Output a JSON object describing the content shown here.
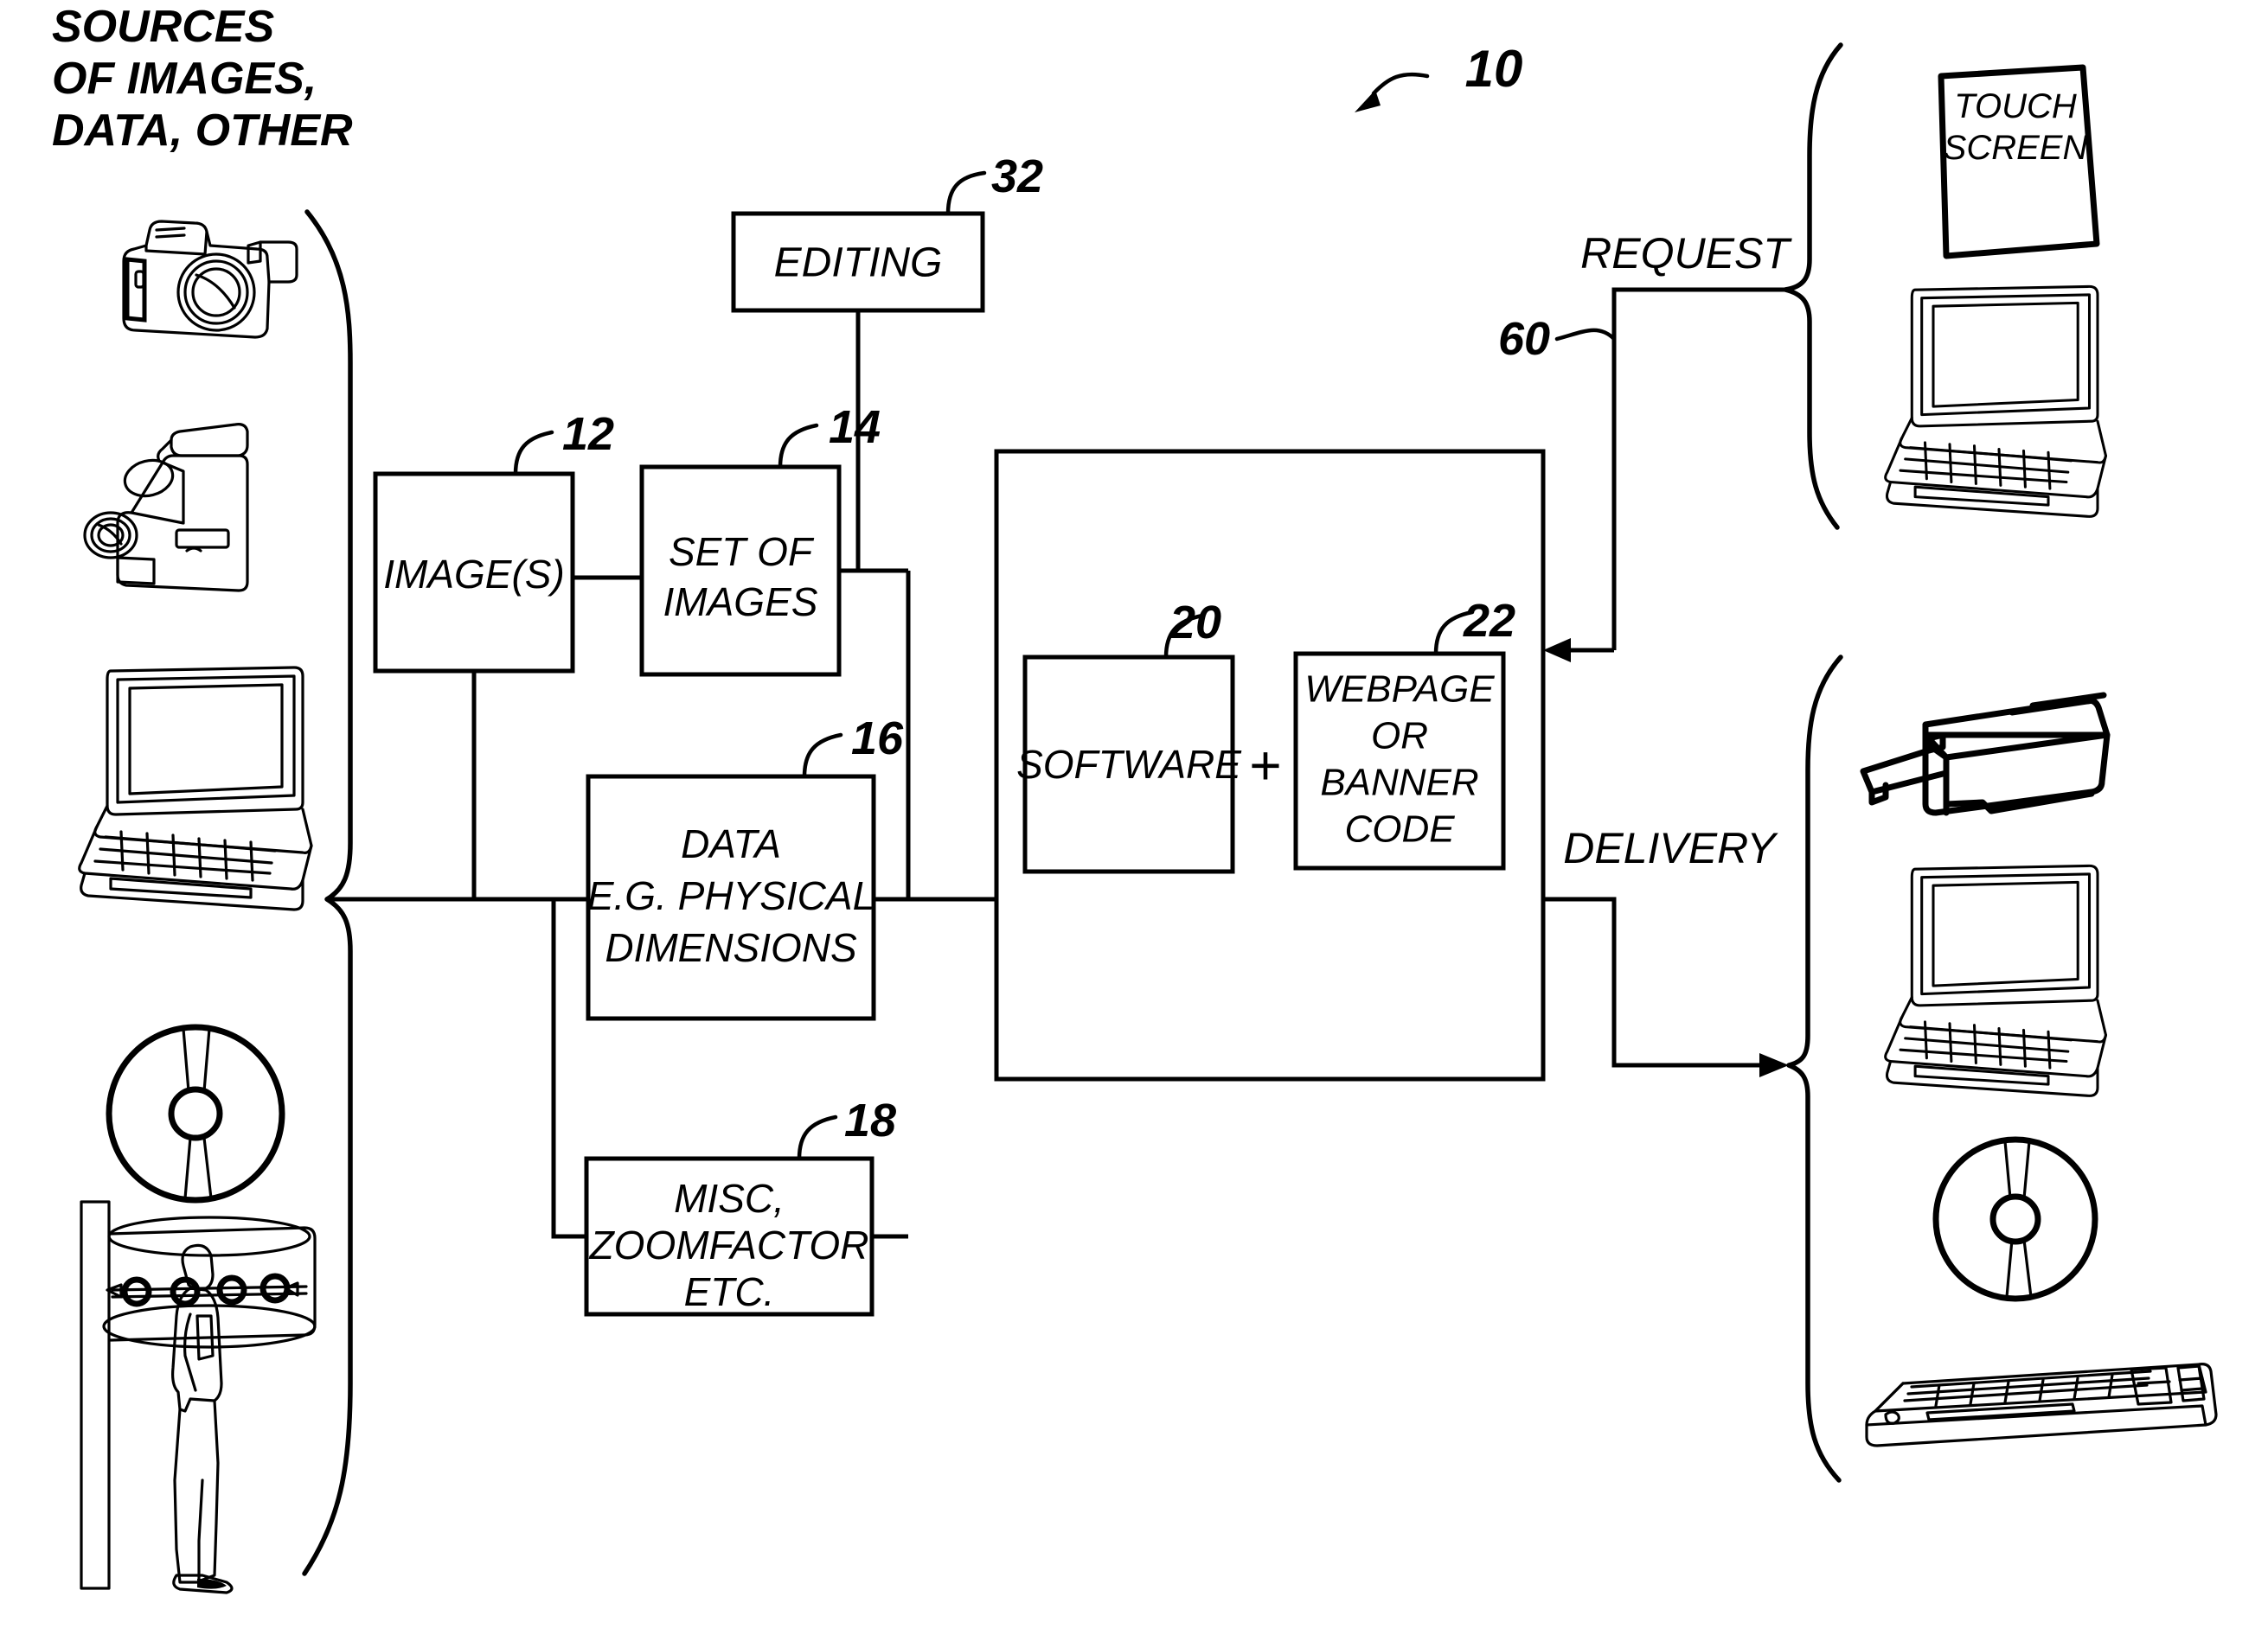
{
  "figure": {
    "title_lines": [
      "SOURCES",
      "OF IMAGES,",
      "DATA, OTHER"
    ],
    "figure_ref": "10"
  },
  "boxes": {
    "editing": {
      "ref": "32",
      "lines": [
        "EDITING"
      ]
    },
    "images": {
      "ref": "12",
      "lines": [
        "IMAGE(S)"
      ]
    },
    "set_of_images": {
      "ref": "14",
      "lines": [
        "SET OF",
        "IMAGES"
      ]
    },
    "data": {
      "ref": "16",
      "lines": [
        "DATA",
        "E.G. PHYSICAL",
        "DIMENSIONS"
      ]
    },
    "misc": {
      "ref": "18",
      "lines": [
        "MISC,",
        "ZOOMFACTOR",
        "ETC."
      ]
    },
    "software": {
      "ref": "20",
      "lines": [
        "SOFTWARE"
      ]
    },
    "webpage": {
      "ref": "22",
      "lines": [
        "WEBPAGE",
        "OR",
        "BANNER",
        "CODE"
      ]
    },
    "plus_sign": "+"
  },
  "flows": {
    "request": {
      "label": "REQUEST",
      "ref": "60"
    },
    "delivery": {
      "label": "DELIVERY"
    }
  },
  "devices": {
    "touch_screen": {
      "lines": [
        "TOUCH",
        "SCREEN"
      ]
    },
    "source_icons": [
      "slr-camera-icon",
      "camcorder-icon",
      "laptop-icon",
      "compact-disc-icon",
      "body-scanner-icon"
    ],
    "request_side_icons": [
      "touch-screen-tablet-icon",
      "laptop-icon"
    ],
    "delivery_side_icons": [
      "printer-icon",
      "laptop-icon",
      "compact-disc-icon",
      "keyboard-icon"
    ]
  },
  "colors": {
    "ink": "#000000",
    "paper": "#ffffff"
  }
}
